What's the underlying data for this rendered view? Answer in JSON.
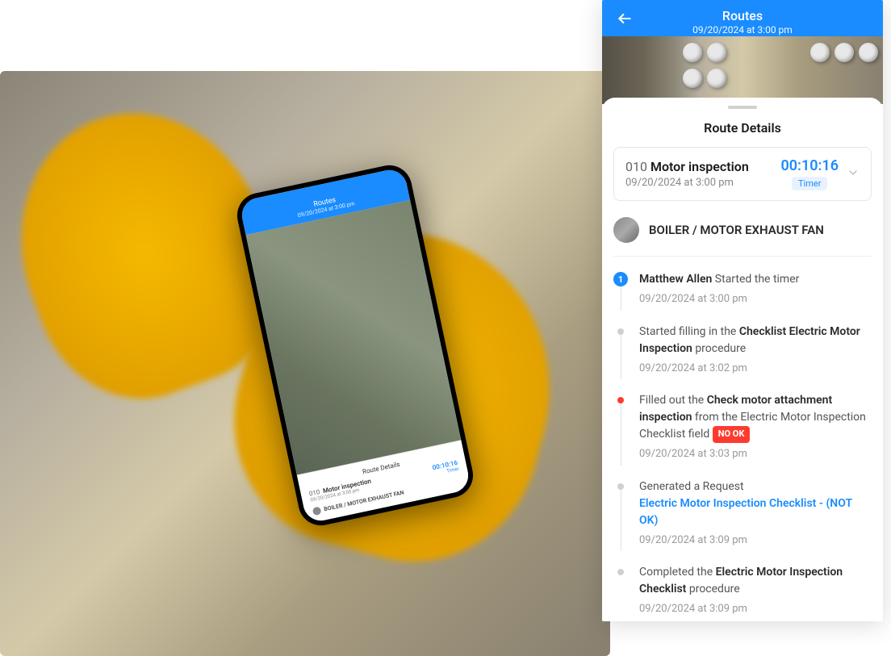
{
  "header": {
    "title": "Routes",
    "subtitle": "09/20/2024 at 3:00 pm"
  },
  "details": {
    "panel_title": "Route Details",
    "task": {
      "id": "010",
      "name": "Motor inspection",
      "date": "09/20/2024 at 3:00 pm",
      "timer_value": "00:10:16",
      "timer_label": "Timer"
    },
    "asset": {
      "name": "BOILER / MOTOR EXHAUST FAN"
    }
  },
  "timeline": [
    {
      "marker": "badge",
      "badge_text": "1",
      "parts": [
        {
          "text": "Matthew Allen ",
          "strong": true
        },
        {
          "text": "Started the timer"
        }
      ],
      "date": "09/20/2024 at 3:00 pm"
    },
    {
      "marker": "dot",
      "parts": [
        {
          "text": "Started filling in the "
        },
        {
          "text": "Checklist Electric Motor Inspection",
          "strong": true
        },
        {
          "text": " procedure"
        }
      ],
      "date": "09/20/2024 at 3:02 pm"
    },
    {
      "marker": "dot-red",
      "parts": [
        {
          "text": "Filled out the "
        },
        {
          "text": "Check motor attachment inspection",
          "strong": true
        },
        {
          "text": " from the Electric Motor Inspection Checklist field "
        },
        {
          "text": "NO OK",
          "badge": true
        }
      ],
      "date": "09/20/2024 at 3:03 pm"
    },
    {
      "marker": "dot",
      "parts": [
        {
          "text": "Generated a Request"
        },
        {
          "br": true
        },
        {
          "text": "Electric Motor Inspection Checklist - (NOT OK)",
          "link": true
        }
      ],
      "date": "09/20/2024 at 3:09 pm"
    },
    {
      "marker": "dot",
      "parts": [
        {
          "text": "Completed the "
        },
        {
          "text": "Electric Motor Inspection Checklist",
          "strong": true
        },
        {
          "text": " procedure"
        }
      ],
      "date": "09/20/2024 at 3:09 pm"
    }
  ],
  "phone": {
    "header_title": "Routes",
    "header_subtitle": "09/20/2024 at 3:00 pm",
    "details_title": "Route Details",
    "task_id": "010",
    "task_name": "Motor inspection",
    "task_date": "09/20/2024 at 3:00 pm",
    "timer": "00:10:16",
    "timer_label": "Timer",
    "asset": "BOILER / MOTOR EXHAUST FAN"
  }
}
